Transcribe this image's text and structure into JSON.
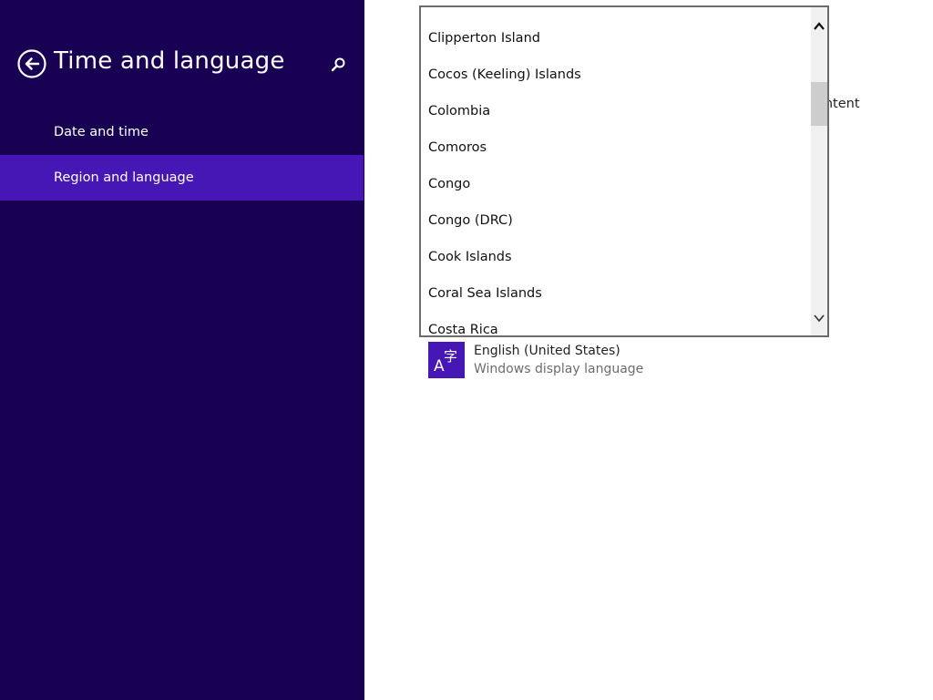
{
  "header": {
    "title": "Time and language",
    "back_icon": "back-arrow-icon",
    "search_icon": "search-icon"
  },
  "nav": {
    "items": [
      {
        "label": "Date and time",
        "selected": false
      },
      {
        "label": "Region and language",
        "selected": true
      }
    ]
  },
  "dropdown": {
    "items": [
      "Clipperton Island",
      "Cocos (Keeling) Islands",
      "Colombia",
      "Comoros",
      "Congo",
      "Congo (DRC)",
      "Cook Islands",
      "Coral Sea Islands",
      "Costa Rica"
    ]
  },
  "behind": {
    "partial_text": "ontent"
  },
  "language": {
    "name": "English (United States)",
    "description": "Windows display language",
    "icon": "language-icon"
  },
  "colors": {
    "pane_bg": "#180052",
    "accent": "#4617b4",
    "text_light": "#ffffff"
  }
}
